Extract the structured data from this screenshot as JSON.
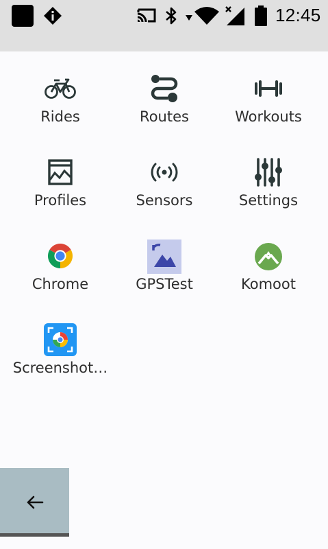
{
  "status_bar": {
    "time": "12:45",
    "icons": [
      "app-square-icon",
      "alert-diamond-icon",
      "cast-icon",
      "bluetooth-icon",
      "data-arrow-icon",
      "wifi-icon",
      "signal-icon",
      "battery-icon"
    ]
  },
  "apps": [
    {
      "label": "Rides",
      "icon": "bike-icon"
    },
    {
      "label": "Routes",
      "icon": "route-icon"
    },
    {
      "label": "Workouts",
      "icon": "dumbbell-icon"
    },
    {
      "label": "Profiles",
      "icon": "profile-card-icon"
    },
    {
      "label": "Sensors",
      "icon": "sensor-signal-icon"
    },
    {
      "label": "Settings",
      "icon": "sliders-icon"
    },
    {
      "label": "Chrome",
      "icon": "chrome-icon"
    },
    {
      "label": "GPSTest",
      "icon": "gpstest-icon"
    },
    {
      "label": "Komoot",
      "icon": "komoot-icon"
    },
    {
      "label": "Screenshot…",
      "icon": "screenshot-app-icon"
    }
  ],
  "nav": {
    "back_icon": "back-arrow-icon"
  },
  "colors": {
    "status_bar_bg": "#e0e0e0",
    "background": "#fbfbfd",
    "back_button_bg": "#a9bcc3",
    "icon_dark": "#2b3838",
    "komoot_green": "#6aa84f"
  }
}
